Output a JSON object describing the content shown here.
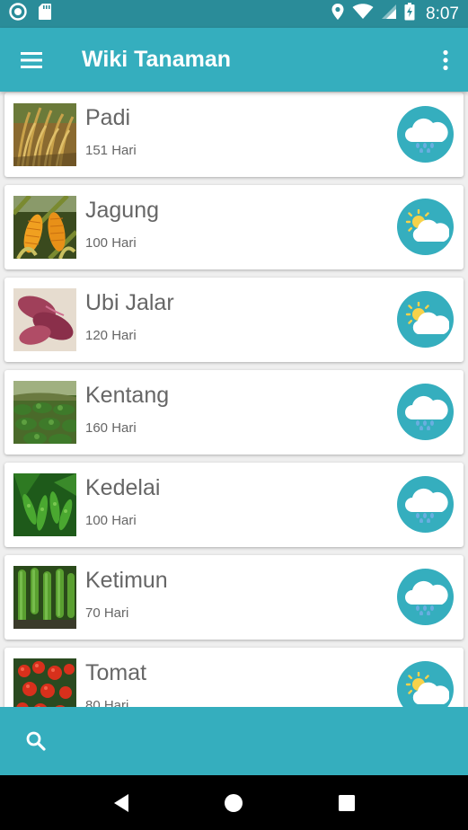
{
  "status_bar": {
    "time": "8:07",
    "icons": [
      "circle-notification-icon",
      "sd-card-icon",
      "location-icon",
      "wifi-icon",
      "signal-icon",
      "battery-charging-icon"
    ]
  },
  "app_bar": {
    "title": "Wiki Tanaman",
    "menu_icon": "hamburger-menu-icon",
    "overflow_icon": "more-vert-icon"
  },
  "plants": [
    {
      "name": "Padi",
      "duration": "151 Hari",
      "weather": "rain-cloud-icon"
    },
    {
      "name": "Jagung",
      "duration": "100 Hari",
      "weather": "sun-cloud-icon"
    },
    {
      "name": "Ubi Jalar",
      "duration": "120 Hari",
      "weather": "sun-cloud-icon"
    },
    {
      "name": "Kentang",
      "duration": "160 Hari",
      "weather": "rain-cloud-icon"
    },
    {
      "name": "Kedelai",
      "duration": "100 Hari",
      "weather": "rain-cloud-icon"
    },
    {
      "name": "Ketimun",
      "duration": "70 Hari",
      "weather": "rain-cloud-icon"
    },
    {
      "name": "Tomat",
      "duration": "80 Hari",
      "weather": "sun-cloud-icon"
    }
  ],
  "bottom_bar": {
    "search_icon": "search-icon"
  },
  "nav_bar": {
    "back_icon": "back-triangle-icon",
    "home_icon": "home-circle-icon",
    "recents_icon": "recents-square-icon"
  },
  "colors": {
    "primary": "#35aebe",
    "primary_dark": "#2a8c99",
    "text": "#666666"
  }
}
